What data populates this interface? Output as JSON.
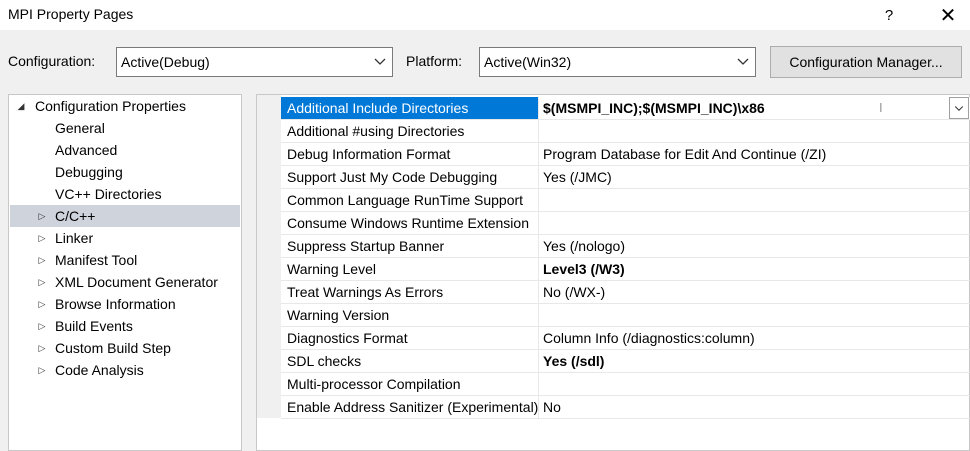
{
  "window": {
    "title": "MPI Property Pages",
    "help_label": "?",
    "close_label": "✕"
  },
  "toolbar": {
    "configuration_label": "Configuration:",
    "configuration_value": "Active(Debug)",
    "platform_label": "Platform:",
    "platform_value": "Active(Win32)",
    "config_manager_label": "Configuration Manager..."
  },
  "tree": {
    "items": [
      {
        "label": "Configuration Properties",
        "glyph": "◢",
        "level": 0,
        "selected": false
      },
      {
        "label": "General",
        "glyph": "",
        "level": 1,
        "selected": false
      },
      {
        "label": "Advanced",
        "glyph": "",
        "level": 1,
        "selected": false
      },
      {
        "label": "Debugging",
        "glyph": "",
        "level": 1,
        "selected": false
      },
      {
        "label": "VC++ Directories",
        "glyph": "",
        "level": 1,
        "selected": false
      },
      {
        "label": "C/C++",
        "glyph": "▷",
        "level": 1,
        "selected": true
      },
      {
        "label": "Linker",
        "glyph": "▷",
        "level": 1,
        "selected": false
      },
      {
        "label": "Manifest Tool",
        "glyph": "▷",
        "level": 1,
        "selected": false
      },
      {
        "label": "XML Document Generator",
        "glyph": "▷",
        "level": 1,
        "selected": false
      },
      {
        "label": "Browse Information",
        "glyph": "▷",
        "level": 1,
        "selected": false
      },
      {
        "label": "Build Events",
        "glyph": "▷",
        "level": 1,
        "selected": false
      },
      {
        "label": "Custom Build Step",
        "glyph": "▷",
        "level": 1,
        "selected": false
      },
      {
        "label": "Code Analysis",
        "glyph": "▷",
        "level": 1,
        "selected": false
      }
    ]
  },
  "properties": {
    "rows": [
      {
        "name": "Additional Include Directories",
        "value": "$(MSMPI_INC);$(MSMPI_INC)\\x86",
        "bold": true,
        "selected": true
      },
      {
        "name": "Additional #using Directories",
        "value": "",
        "bold": false,
        "selected": false
      },
      {
        "name": "Debug Information Format",
        "value": "Program Database for Edit And Continue (/ZI)",
        "bold": false,
        "selected": false
      },
      {
        "name": "Support Just My Code Debugging",
        "value": "Yes (/JMC)",
        "bold": false,
        "selected": false
      },
      {
        "name": "Common Language RunTime Support",
        "value": "",
        "bold": false,
        "selected": false
      },
      {
        "name": "Consume Windows Runtime Extension",
        "value": "",
        "bold": false,
        "selected": false
      },
      {
        "name": "Suppress Startup Banner",
        "value": "Yes (/nologo)",
        "bold": false,
        "selected": false
      },
      {
        "name": "Warning Level",
        "value": "Level3 (/W3)",
        "bold": true,
        "selected": false
      },
      {
        "name": "Treat Warnings As Errors",
        "value": "No (/WX-)",
        "bold": false,
        "selected": false
      },
      {
        "name": "Warning Version",
        "value": "",
        "bold": false,
        "selected": false
      },
      {
        "name": "Diagnostics Format",
        "value": "Column Info (/diagnostics:column)",
        "bold": false,
        "selected": false
      },
      {
        "name": "SDL checks",
        "value": "Yes (/sdl)",
        "bold": true,
        "selected": false
      },
      {
        "name": "Multi-processor Compilation",
        "value": "",
        "bold": false,
        "selected": false
      },
      {
        "name": "Enable Address Sanitizer (Experimental)",
        "value": "No",
        "bold": false,
        "selected": false
      }
    ]
  },
  "colors": {
    "selection": "#0078d7",
    "tree_selection": "#cfd3dc"
  },
  "icons": [
    "help-icon",
    "close-icon",
    "chevron-down-icon",
    "expand-arrow-icon",
    "collapse-arrow-icon"
  ]
}
